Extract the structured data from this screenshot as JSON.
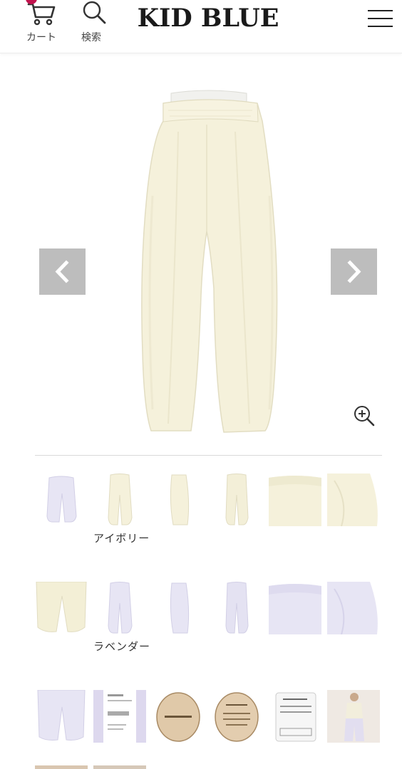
{
  "header": {
    "cart_badge": "1",
    "cart_label": "カート",
    "search_label": "検索",
    "logo": "KID BLUE"
  },
  "viewer": {
    "main_image": "ivory-wide-pants-front",
    "prev_icon": "chevron-left-icon",
    "next_icon": "chevron-right-icon",
    "zoom_icon": "zoom-in-icon"
  },
  "colors": {
    "ivory": "#f4f0d9",
    "lavender": "#e6e4f3",
    "arrow_bg": "#bdbdbd",
    "badge": "#c1144e"
  },
  "thumbnail_rows": [
    {
      "items": [
        "lavender-front",
        "ivory-front",
        "ivory-side",
        "ivory-back",
        "ivory-waist-detail",
        "ivory-hem-detail"
      ]
    },
    {
      "items": [
        "ivory-pocket-detail",
        "lavender-front",
        "lavender-side",
        "lavender-back",
        "lavender-waist-detail",
        "lavender-hem-detail"
      ]
    },
    {
      "items": [
        "lavender-leg-detail",
        "care-label-tag",
        "organic-cotton-tag",
        "brand-hang-tag",
        "care-notice-tag",
        "model-photo"
      ]
    }
  ],
  "color_labels": {
    "ivory": "アイボリー",
    "lavender": "ラベンダー"
  }
}
